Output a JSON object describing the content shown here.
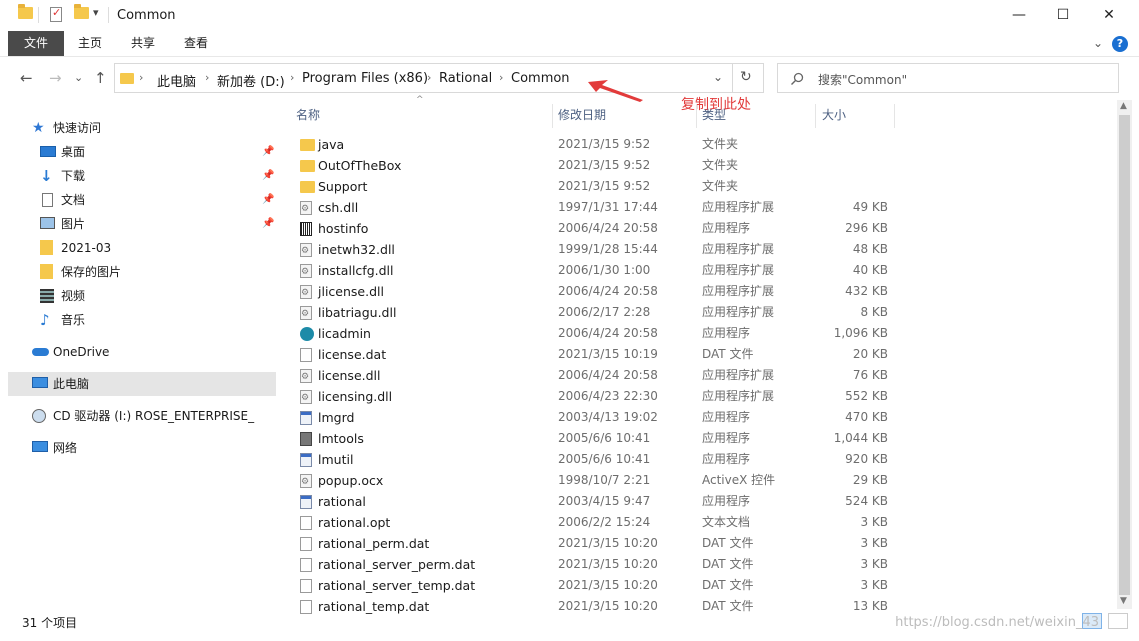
{
  "window": {
    "title": "Common",
    "minimize": "—",
    "maximize": "☐",
    "close": "✕"
  },
  "ribbon": {
    "tabs": [
      "文件",
      "主页",
      "共享",
      "查看"
    ],
    "expand": "⌄",
    "help": "?"
  },
  "nav": {
    "back": "←",
    "forward": "→",
    "recent": "⌄",
    "up": "↑",
    "refresh": "↻",
    "addr_dropdown": "⌄"
  },
  "breadcrumb": [
    "此电脑",
    "新加卷 (D:)",
    "Program Files (x86)",
    "Rational",
    "Common"
  ],
  "search": {
    "placeholder": "搜索\"Common\"",
    "icon": "search-icon"
  },
  "annotation": {
    "text": "复制到此处",
    "color": "#e23b3b"
  },
  "sidebar": {
    "quick_access": "快速访问",
    "items": [
      {
        "label": "桌面",
        "icon": "desktop-icon",
        "pinned": true
      },
      {
        "label": "下载",
        "icon": "download-icon",
        "pinned": true
      },
      {
        "label": "文档",
        "icon": "documents-icon",
        "pinned": true
      },
      {
        "label": "图片",
        "icon": "pictures-icon",
        "pinned": true
      },
      {
        "label": "2021-03",
        "icon": "folder-icon",
        "pinned": false
      },
      {
        "label": "保存的图片",
        "icon": "folder-icon",
        "pinned": false
      },
      {
        "label": "视频",
        "icon": "videos-icon",
        "pinned": false
      },
      {
        "label": "音乐",
        "icon": "music-icon",
        "pinned": false
      }
    ],
    "onedrive": "OneDrive",
    "this_pc": "此电脑",
    "cd_drive": "CD 驱动器 (I:) ROSE_ENTERPRISE_",
    "network": "网络"
  },
  "columns": {
    "name": "名称",
    "date": "修改日期",
    "type": "类型",
    "size": "大小"
  },
  "files": [
    {
      "name": "java",
      "date": "2021/3/15 9:52",
      "type": "文件夹",
      "size": "",
      "icon": "folder"
    },
    {
      "name": "OutOfTheBox",
      "date": "2021/3/15 9:52",
      "type": "文件夹",
      "size": "",
      "icon": "folder"
    },
    {
      "name": "Support",
      "date": "2021/3/15 9:52",
      "type": "文件夹",
      "size": "",
      "icon": "folder"
    },
    {
      "name": "csh.dll",
      "date": "1997/1/31 17:44",
      "type": "应用程序扩展",
      "size": "49 KB",
      "icon": "dll"
    },
    {
      "name": "hostinfo",
      "date": "2006/4/24 20:58",
      "type": "应用程序",
      "size": "296 KB",
      "icon": "barcode"
    },
    {
      "name": "inetwh32.dll",
      "date": "1999/1/28 15:44",
      "type": "应用程序扩展",
      "size": "48 KB",
      "icon": "dll"
    },
    {
      "name": "installcfg.dll",
      "date": "2006/1/30 1:00",
      "type": "应用程序扩展",
      "size": "40 KB",
      "icon": "dll"
    },
    {
      "name": "jlicense.dll",
      "date": "2006/4/24 20:58",
      "type": "应用程序扩展",
      "size": "432 KB",
      "icon": "dll"
    },
    {
      "name": "libatriagu.dll",
      "date": "2006/2/17 2:28",
      "type": "应用程序扩展",
      "size": "8 KB",
      "icon": "dll"
    },
    {
      "name": "licadmin",
      "date": "2006/4/24 20:58",
      "type": "应用程序",
      "size": "1,096 KB",
      "icon": "round"
    },
    {
      "name": "license.dat",
      "date": "2021/3/15 10:19",
      "type": "DAT 文件",
      "size": "20 KB",
      "icon": "doc"
    },
    {
      "name": "license.dll",
      "date": "2006/4/24 20:58",
      "type": "应用程序扩展",
      "size": "76 KB",
      "icon": "dll"
    },
    {
      "name": "licensing.dll",
      "date": "2006/4/23 22:30",
      "type": "应用程序扩展",
      "size": "552 KB",
      "icon": "dll"
    },
    {
      "name": "lmgrd",
      "date": "2003/4/13 19:02",
      "type": "应用程序",
      "size": "470 KB",
      "icon": "exe"
    },
    {
      "name": "lmtools",
      "date": "2005/6/6 10:41",
      "type": "应用程序",
      "size": "1,044 KB",
      "icon": "tool"
    },
    {
      "name": "lmutil",
      "date": "2005/6/6 10:41",
      "type": "应用程序",
      "size": "920 KB",
      "icon": "exe"
    },
    {
      "name": "popup.ocx",
      "date": "1998/10/7 2:21",
      "type": "ActiveX 控件",
      "size": "29 KB",
      "icon": "dll"
    },
    {
      "name": "rational",
      "date": "2003/4/15 9:47",
      "type": "应用程序",
      "size": "524 KB",
      "icon": "exe"
    },
    {
      "name": "rational.opt",
      "date": "2006/2/2 15:24",
      "type": "文本文档",
      "size": "3 KB",
      "icon": "doc"
    },
    {
      "name": "rational_perm.dat",
      "date": "2021/3/15 10:20",
      "type": "DAT 文件",
      "size": "3 KB",
      "icon": "doc"
    },
    {
      "name": "rational_server_perm.dat",
      "date": "2021/3/15 10:20",
      "type": "DAT 文件",
      "size": "3 KB",
      "icon": "doc"
    },
    {
      "name": "rational_server_temp.dat",
      "date": "2021/3/15 10:20",
      "type": "DAT 文件",
      "size": "3 KB",
      "icon": "doc"
    },
    {
      "name": "rational_temp.dat",
      "date": "2021/3/15 10:20",
      "type": "DAT 文件",
      "size": "13 KB",
      "icon": "doc"
    }
  ],
  "status": {
    "count": "31 个项目"
  },
  "watermark": "https://blog.csdn.net/weixin_43"
}
